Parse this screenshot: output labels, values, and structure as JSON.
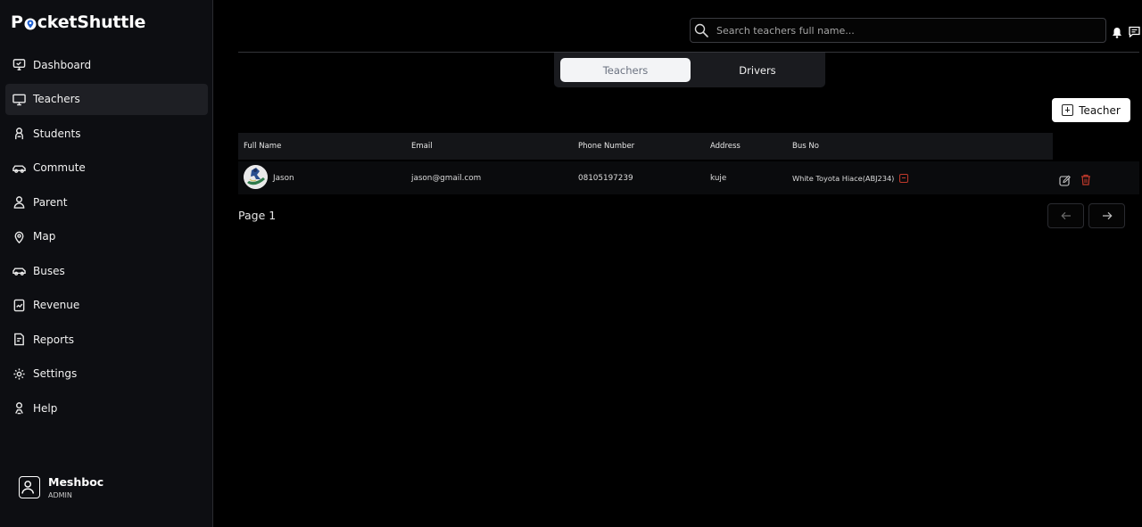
{
  "app": {
    "brand_part1": "P",
    "brand_part2": "cketShuttle"
  },
  "sidebar": {
    "items": [
      {
        "label": "Dashboard",
        "icon": "monitor-icon",
        "active": false
      },
      {
        "label": "Teachers",
        "icon": "screen-icon",
        "active": true
      },
      {
        "label": "Students",
        "icon": "student-icon",
        "active": false
      },
      {
        "label": "Commute",
        "icon": "car-icon",
        "active": false
      },
      {
        "label": "Parent",
        "icon": "person-icon",
        "active": false
      },
      {
        "label": "Map",
        "icon": "map-pin-icon",
        "active": false
      },
      {
        "label": "Buses",
        "icon": "bus-icon",
        "active": false
      },
      {
        "label": "Revenue",
        "icon": "revenue-icon",
        "active": false
      },
      {
        "label": "Reports",
        "icon": "reports-icon",
        "active": false
      },
      {
        "label": "Settings",
        "icon": "gear-icon",
        "active": false
      },
      {
        "label": "Help",
        "icon": "help-icon",
        "active": false
      }
    ]
  },
  "profile": {
    "name": "Meshboc",
    "role": "ADMIN"
  },
  "header": {
    "search_placeholder": "Search teachers full name...",
    "search_value": ""
  },
  "tabs": [
    {
      "label": "Teachers",
      "selected": true
    },
    {
      "label": "Drivers",
      "selected": false
    }
  ],
  "actions": {
    "add_label": "Teacher"
  },
  "table": {
    "columns": [
      "Full Name",
      "Email",
      "Phone Number",
      "Address",
      "Bus No"
    ],
    "rows": [
      {
        "full_name": "Jason",
        "email": "jason@gmail.com",
        "phone": "08105197239",
        "address": "kuje",
        "bus_no": "White Toyota Hiace(ABJ234)"
      }
    ]
  },
  "pagination": {
    "label": "Page 1"
  },
  "colors": {
    "background": "#000000",
    "sidebar": "#0d0e12",
    "active_item": "#1e1f24",
    "danger": "#c0392b"
  }
}
